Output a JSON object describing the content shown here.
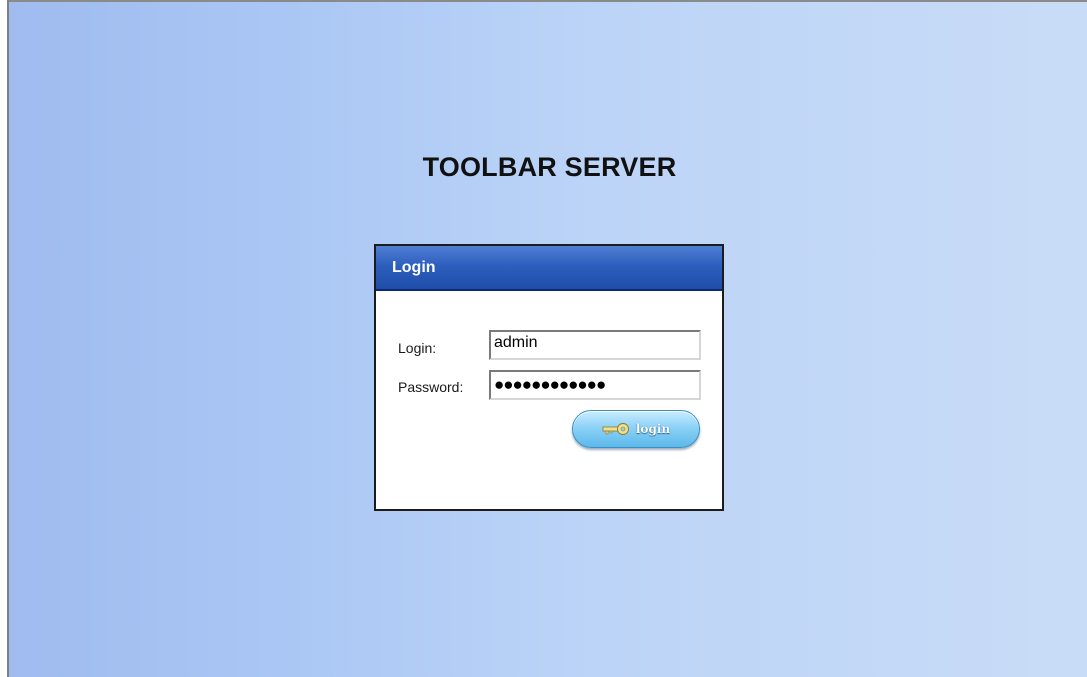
{
  "app": {
    "title": "TOOLBAR SERVER"
  },
  "login_panel": {
    "header": "Login",
    "fields": {
      "login_label": "Login:",
      "login_value": "admin",
      "password_label": "Password:",
      "password_masked": "●●●●●●●●●●●●"
    },
    "submit": {
      "label": "login",
      "icon": "key-icon"
    }
  },
  "colors": {
    "header_blue": "#2d5fbe",
    "button_blue": "#8dd2f7",
    "background_light": "#c9dcf7",
    "background_dark": "#9fbbef"
  }
}
